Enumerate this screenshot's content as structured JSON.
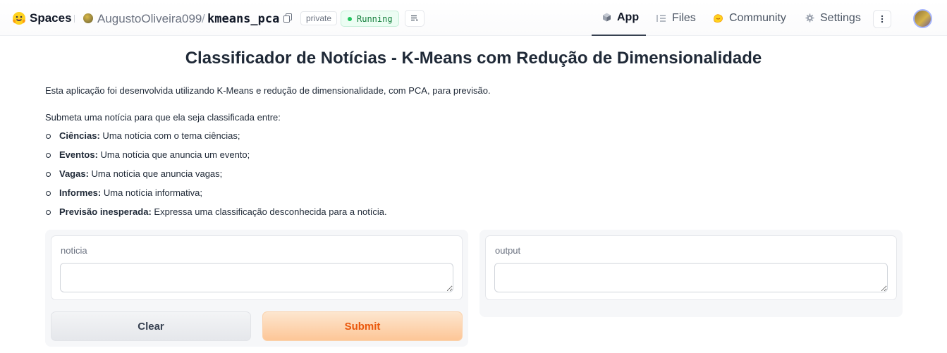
{
  "header": {
    "brand": "Spaces",
    "owner": "AugustoOliveira099",
    "separator": "/",
    "repo": "kmeans_pca",
    "visibility": "private",
    "status": "Running",
    "status_color": "#22c55e",
    "tabs": [
      {
        "label": "App",
        "icon": "app-cube-icon",
        "active": true
      },
      {
        "label": "Files",
        "icon": "files-icon",
        "active": false
      },
      {
        "label": "Community",
        "icon": "community-icon",
        "active": false
      },
      {
        "label": "Settings",
        "icon": "gear-icon",
        "active": false
      }
    ]
  },
  "main": {
    "title": "Classificador de Notícias - K-Means com Redução de Dimensionalidade",
    "intro": "Esta aplicação foi desenvolvida utilizando K-Means e redução de dimensionalidade, com PCA, para previsão.",
    "submit_prompt": "Submeta uma notícia para que ela seja classificada entre:",
    "categories": [
      {
        "name": "Ciências:",
        "desc": " Uma notícia com o tema ciências;"
      },
      {
        "name": "Eventos:",
        "desc": " Uma notícia que anuncia um evento;"
      },
      {
        "name": "Vagas:",
        "desc": " Uma notícia que anuncia vagas;"
      },
      {
        "name": "Informes:",
        "desc": " Uma notícia informativa;"
      },
      {
        "name": "Previsão inesperada:",
        "desc": " Expressa uma classificação desconhecida para a notícia."
      }
    ]
  },
  "input": {
    "label": "noticia",
    "value": "",
    "placeholder": ""
  },
  "output": {
    "label": "output",
    "value": ""
  },
  "buttons": {
    "clear": "Clear",
    "submit": "Submit"
  },
  "colors": {
    "submit_text": "#ea580c",
    "accent": "#fdc697"
  }
}
